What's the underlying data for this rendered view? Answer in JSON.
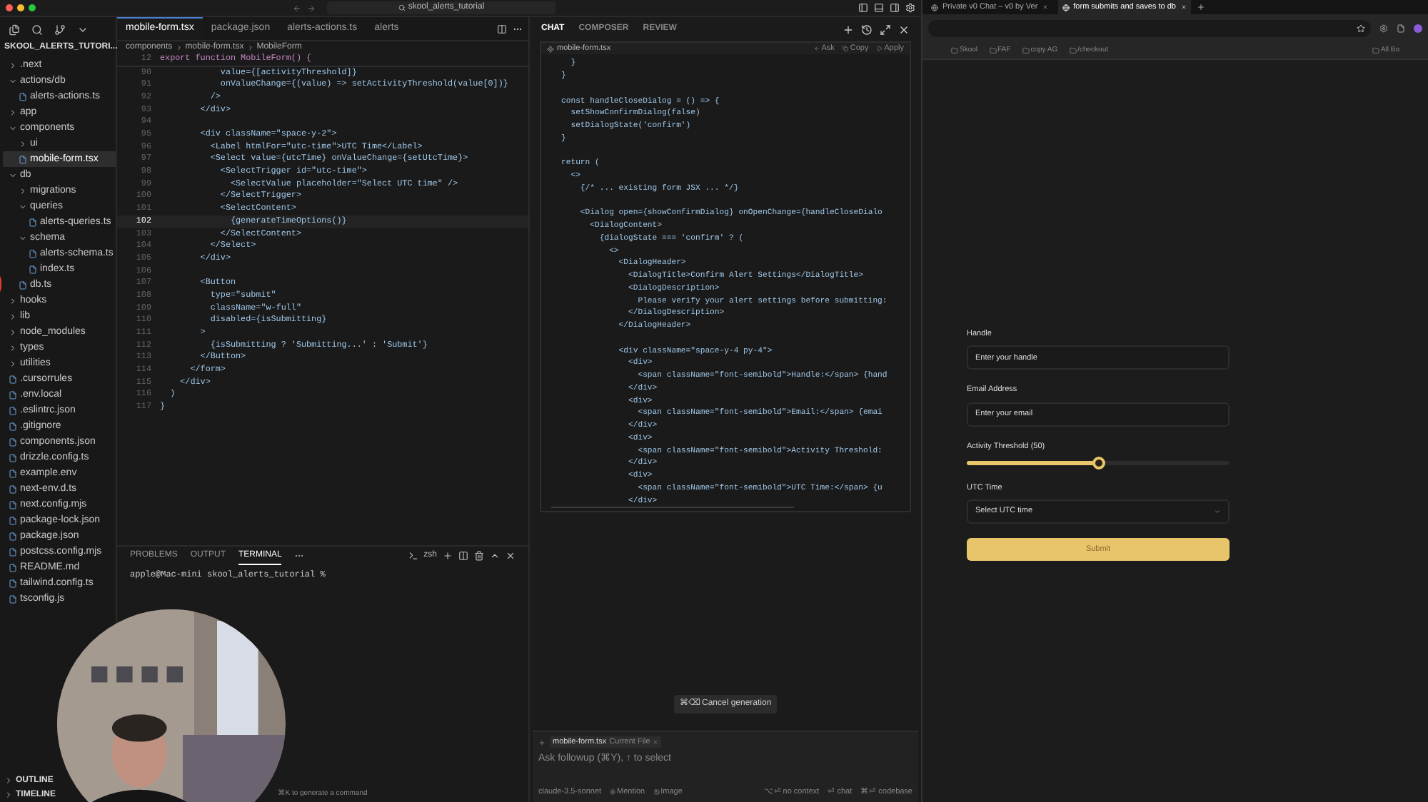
{
  "title_bar": {
    "search": "skool_alerts_tutorial"
  },
  "explorer": {
    "title": "SKOOL_ALERTS_TUTORI...",
    "items": [
      {
        "kind": "folder",
        "name": ".next",
        "expanded": false
      },
      {
        "kind": "folder",
        "name": "actions/db",
        "expanded": true,
        "children": [
          {
            "kind": "file",
            "name": "alerts-actions.ts",
            "selected": false
          }
        ]
      },
      {
        "kind": "folder",
        "name": "app",
        "expanded": false
      },
      {
        "kind": "folder",
        "name": "components",
        "expanded": true,
        "children": [
          {
            "kind": "folder",
            "name": "ui",
            "expanded": false
          },
          {
            "kind": "file",
            "name": "mobile-form.tsx",
            "selected": true
          }
        ]
      },
      {
        "kind": "folder",
        "name": "db",
        "expanded": true,
        "children": [
          {
            "kind": "folder",
            "name": "migrations",
            "expanded": false
          },
          {
            "kind": "folder",
            "name": "queries",
            "expanded": true,
            "children": [
              {
                "kind": "file",
                "name": "alerts-queries.ts",
                "selected": false
              }
            ]
          },
          {
            "kind": "folder",
            "name": "schema",
            "expanded": true,
            "children": [
              {
                "kind": "file",
                "name": "alerts-schema.ts",
                "selected": false
              },
              {
                "kind": "file",
                "name": "index.ts",
                "selected": false
              }
            ]
          },
          {
            "kind": "file",
            "name": "db.ts",
            "selected": false
          }
        ]
      },
      {
        "kind": "folder",
        "name": "hooks",
        "expanded": false
      },
      {
        "kind": "folder",
        "name": "lib",
        "expanded": false
      },
      {
        "kind": "folder",
        "name": "node_modules",
        "expanded": false
      },
      {
        "kind": "folder",
        "name": "types",
        "expanded": false
      },
      {
        "kind": "folder",
        "name": "utilities",
        "expanded": false
      },
      {
        "kind": "file",
        "name": ".cursorrules",
        "selected": false
      },
      {
        "kind": "file",
        "name": ".env.local",
        "selected": false
      },
      {
        "kind": "file",
        "name": ".eslintrc.json",
        "selected": false
      },
      {
        "kind": "file",
        "name": ".gitignore",
        "selected": false
      },
      {
        "kind": "file",
        "name": "components.json",
        "selected": false
      },
      {
        "kind": "file",
        "name": "drizzle.config.ts",
        "selected": false
      },
      {
        "kind": "file",
        "name": "example.env",
        "selected": false
      },
      {
        "kind": "file",
        "name": "next-env.d.ts",
        "selected": false
      },
      {
        "kind": "file",
        "name": "next.config.mjs",
        "selected": false
      },
      {
        "kind": "file",
        "name": "package-lock.json",
        "selected": false
      },
      {
        "kind": "file",
        "name": "package.json",
        "selected": false
      },
      {
        "kind": "file",
        "name": "postcss.config.mjs",
        "selected": false
      },
      {
        "kind": "file",
        "name": "README.md",
        "selected": false
      },
      {
        "kind": "file",
        "name": "tailwind.config.ts",
        "selected": false
      },
      {
        "kind": "file",
        "name": "tsconfig.js",
        "selected": false
      }
    ],
    "sections": [
      "OUTLINE",
      "TIMELINE"
    ]
  },
  "editor": {
    "tabs": [
      {
        "label": "mobile-form.tsx",
        "selected": true
      },
      {
        "label": "package.json",
        "selected": false
      },
      {
        "label": "alerts-actions.ts",
        "selected": false
      },
      {
        "label": "alerts",
        "selected": false
      }
    ],
    "breadcrumb": [
      "components",
      "mobile-form.tsx",
      "MobileForm"
    ],
    "sticky": {
      "num": "12",
      "text": "export function MobileForm() {"
    },
    "lines": [
      {
        "num": "90",
        "text": "            value={[activityThreshold]}",
        "current": false
      },
      {
        "num": "91",
        "text": "            onValueChange={(value) => setActivityThreshold(value[0])}",
        "current": false
      },
      {
        "num": "92",
        "text": "          />",
        "current": false
      },
      {
        "num": "93",
        "text": "        </div>",
        "current": false
      },
      {
        "num": "94",
        "current": false
      },
      {
        "num": "95",
        "text": "        <div className=\"space-y-2\">",
        "current": false
      },
      {
        "num": "96",
        "text": "          <Label htmlFor=\"utc-time\">UTC Time</Label>",
        "current": false
      },
      {
        "num": "97",
        "text": "          <Select value={utcTime} onValueChange={setUtcTime}>",
        "current": false
      },
      {
        "num": "98",
        "text": "            <SelectTrigger id=\"utc-time\">",
        "current": false
      },
      {
        "num": "99",
        "text": "              <SelectValue placeholder=\"Select UTC time\" />",
        "current": false
      },
      {
        "num": "100",
        "text": "            </SelectTrigger>",
        "current": false
      },
      {
        "num": "101",
        "text": "            <SelectContent>",
        "current": false
      },
      {
        "num": "102",
        "text": "              {generateTimeOptions()}",
        "current": true
      },
      {
        "num": "103",
        "text": "            </SelectContent>",
        "current": false
      },
      {
        "num": "104",
        "text": "          </Select>",
        "current": false
      },
      {
        "num": "105",
        "text": "        </div>",
        "current": false
      },
      {
        "num": "106",
        "current": false
      },
      {
        "num": "107",
        "text": "        <Button",
        "current": false
      },
      {
        "num": "108",
        "text": "          type=\"submit\"",
        "current": false
      },
      {
        "num": "109",
        "text": "          className=\"w-full\"",
        "current": false
      },
      {
        "num": "110",
        "text": "          disabled={isSubmitting}",
        "current": false
      },
      {
        "num": "111",
        "text": "        >",
        "current": false
      },
      {
        "num": "112",
        "text": "          {isSubmitting ? 'Submitting...' : 'Submit'}",
        "current": false
      },
      {
        "num": "113",
        "text": "        </Button>",
        "current": false
      },
      {
        "num": "114",
        "text": "      </form>",
        "current": false
      },
      {
        "num": "115",
        "text": "    </div>",
        "current": false
      },
      {
        "num": "116",
        "text": "  )",
        "current": false
      },
      {
        "num": "117",
        "text": "}",
        "current": false
      }
    ]
  },
  "panel": {
    "tabs": [
      {
        "label": "PROBLEMS",
        "selected": false
      },
      {
        "label": "OUTPUT",
        "selected": false
      },
      {
        "label": "TERMINAL",
        "selected": true
      }
    ],
    "shell": "zsh",
    "prompt": "apple@Mac-mini skool_alerts_tutorial %"
  },
  "status_hint": "⌘K to generate a command",
  "chat": {
    "tabs": [
      {
        "label": "CHAT",
        "selected": true
      },
      {
        "label": "COMPOSER",
        "selected": false
      },
      {
        "label": "REVIEW",
        "selected": false
      }
    ],
    "code_file": "mobile-form.tsx",
    "code_actions": [
      "Ask",
      "Copy",
      "Apply"
    ],
    "blocks": [
      [
        "  }",
        "}"
      ],
      [
        "const handleCloseDialog = () => {",
        "  setShowConfirmDialog(false)",
        "  setDialogState('confirm')",
        "}"
      ],
      [
        "return (",
        "  <>",
        "    {/* ... existing form JSX ... */}"
      ],
      [
        "    <Dialog open={showConfirmDialog} onOpenChange={handleCloseDialo",
        "      <DialogContent>",
        "        {dialogState === 'confirm' ? (",
        "          <>",
        "            <DialogHeader>",
        "              <DialogTitle>Confirm Alert Settings</DialogTitle>",
        "              <DialogDescription>",
        "                Please verify your alert settings before submitting:",
        "              </DialogDescription>",
        "            </DialogHeader>"
      ],
      [
        "            <div className=\"space-y-4 py-4\">",
        "              <div>",
        "                <span className=\"font-semibold\">Handle:</span> {hand",
        "              </div>",
        "              <div>",
        "                <span className=\"font-semibold\">Email:</span> {emai",
        "              </div>",
        "              <div>",
        "                <span className=\"font-semibold\">Activity Threshold:",
        "              </div>",
        "              <div>",
        "                <span className=\"font-semibold\">UTC Time:</span> {u",
        "              </div>"
      ]
    ],
    "cancel": "⌘⌫ Cancel generation",
    "input": {
      "chip": "mobile-form.tsx",
      "chip_note": "Current File",
      "placeholder": "Ask followup (⌘Y), ↑ to select",
      "model": "claude-3.5-sonnet",
      "mention": "Mention",
      "image": "Image",
      "modes": [
        "⌥⏎ no context",
        "⏎ chat",
        "⌘⏎ codebase"
      ]
    }
  },
  "browser": {
    "tabs": [
      {
        "label": "Private v0 Chat – v0 by Ver",
        "selected": false
      },
      {
        "label": "form submits and saves to db",
        "selected": true
      }
    ],
    "bookmarks": [
      "Skool",
      "FAF",
      "copy AG",
      "/checkout",
      "All Bo"
    ],
    "form": {
      "fields": [
        {
          "label": "Handle",
          "placeholder": "Enter your handle"
        },
        {
          "label": "Email Address",
          "placeholder": "Enter your email"
        }
      ],
      "slider": {
        "label": "Activity Threshold (50)",
        "level": 0.5
      },
      "select": {
        "label": "UTC Time",
        "placeholder": "Select UTC time"
      },
      "submit": "Submit"
    }
  }
}
